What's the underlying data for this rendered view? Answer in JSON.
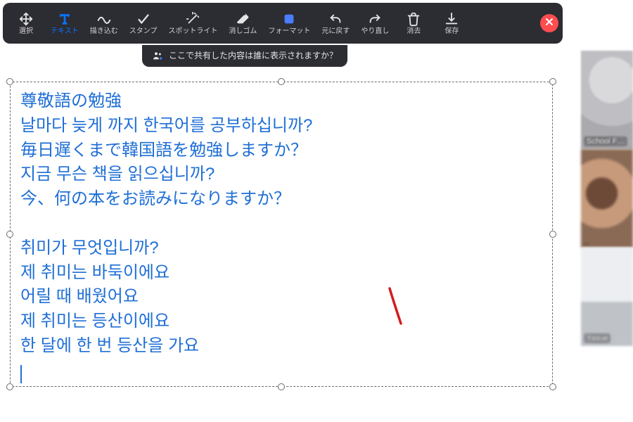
{
  "toolbar": {
    "select": "選択",
    "text": "テキスト",
    "draw": "描き込む",
    "stamp": "スタンプ",
    "spotlight": "スポットライト",
    "eraser": "消しゴム",
    "format": "フォーマット",
    "undo": "元に戻す",
    "redo": "やり直し",
    "clear": "消去",
    "save": "保存"
  },
  "privacy_notice": "ここで共有した内容は誰に表示されますか？",
  "text_box": {
    "lines": [
      "尊敬語の勉強",
      "날마다 늦게 까지 한국어를 공부하십니까?",
      "毎日遅くまで韓国語を勉強しますか？",
      "지금 무슨 책을 읽으십니까?",
      "今、何の本をお読みになりますか？",
      "",
      "취미가 무엇입니까?",
      "제 취미는 바둑이에요",
      "어릴 때 배웠어요",
      "제 취미는 등산이에요",
      "한 달에 한 번 등산을 가요"
    ]
  },
  "participants": [
    {
      "name": "School F…"
    },
    {
      "name": ""
    },
    {
      "name": "Yasue"
    }
  ],
  "colors": {
    "accent": "#0a74ff",
    "text_ink": "#1f6fd6",
    "toolbar_bg": "#2c2c33",
    "close_red": "#ff4d4f",
    "stroke_red": "#d41c1c"
  }
}
